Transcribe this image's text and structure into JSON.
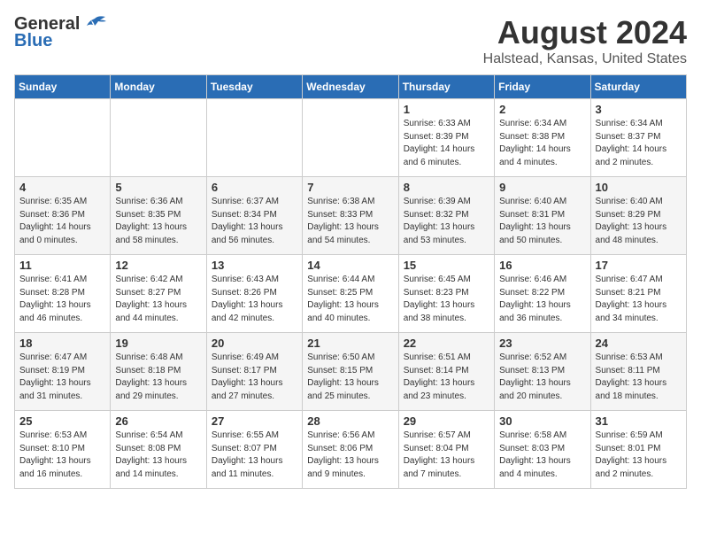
{
  "header": {
    "logo_general": "General",
    "logo_blue": "Blue",
    "month": "August 2024",
    "location": "Halstead, Kansas, United States"
  },
  "weekdays": [
    "Sunday",
    "Monday",
    "Tuesday",
    "Wednesday",
    "Thursday",
    "Friday",
    "Saturday"
  ],
  "weeks": [
    [
      {
        "day": "",
        "info": ""
      },
      {
        "day": "",
        "info": ""
      },
      {
        "day": "",
        "info": ""
      },
      {
        "day": "",
        "info": ""
      },
      {
        "day": "1",
        "info": "Sunrise: 6:33 AM\nSunset: 8:39 PM\nDaylight: 14 hours\nand 6 minutes."
      },
      {
        "day": "2",
        "info": "Sunrise: 6:34 AM\nSunset: 8:38 PM\nDaylight: 14 hours\nand 4 minutes."
      },
      {
        "day": "3",
        "info": "Sunrise: 6:34 AM\nSunset: 8:37 PM\nDaylight: 14 hours\nand 2 minutes."
      }
    ],
    [
      {
        "day": "4",
        "info": "Sunrise: 6:35 AM\nSunset: 8:36 PM\nDaylight: 14 hours\nand 0 minutes."
      },
      {
        "day": "5",
        "info": "Sunrise: 6:36 AM\nSunset: 8:35 PM\nDaylight: 13 hours\nand 58 minutes."
      },
      {
        "day": "6",
        "info": "Sunrise: 6:37 AM\nSunset: 8:34 PM\nDaylight: 13 hours\nand 56 minutes."
      },
      {
        "day": "7",
        "info": "Sunrise: 6:38 AM\nSunset: 8:33 PM\nDaylight: 13 hours\nand 54 minutes."
      },
      {
        "day": "8",
        "info": "Sunrise: 6:39 AM\nSunset: 8:32 PM\nDaylight: 13 hours\nand 53 minutes."
      },
      {
        "day": "9",
        "info": "Sunrise: 6:40 AM\nSunset: 8:31 PM\nDaylight: 13 hours\nand 50 minutes."
      },
      {
        "day": "10",
        "info": "Sunrise: 6:40 AM\nSunset: 8:29 PM\nDaylight: 13 hours\nand 48 minutes."
      }
    ],
    [
      {
        "day": "11",
        "info": "Sunrise: 6:41 AM\nSunset: 8:28 PM\nDaylight: 13 hours\nand 46 minutes."
      },
      {
        "day": "12",
        "info": "Sunrise: 6:42 AM\nSunset: 8:27 PM\nDaylight: 13 hours\nand 44 minutes."
      },
      {
        "day": "13",
        "info": "Sunrise: 6:43 AM\nSunset: 8:26 PM\nDaylight: 13 hours\nand 42 minutes."
      },
      {
        "day": "14",
        "info": "Sunrise: 6:44 AM\nSunset: 8:25 PM\nDaylight: 13 hours\nand 40 minutes."
      },
      {
        "day": "15",
        "info": "Sunrise: 6:45 AM\nSunset: 8:23 PM\nDaylight: 13 hours\nand 38 minutes."
      },
      {
        "day": "16",
        "info": "Sunrise: 6:46 AM\nSunset: 8:22 PM\nDaylight: 13 hours\nand 36 minutes."
      },
      {
        "day": "17",
        "info": "Sunrise: 6:47 AM\nSunset: 8:21 PM\nDaylight: 13 hours\nand 34 minutes."
      }
    ],
    [
      {
        "day": "18",
        "info": "Sunrise: 6:47 AM\nSunset: 8:19 PM\nDaylight: 13 hours\nand 31 minutes."
      },
      {
        "day": "19",
        "info": "Sunrise: 6:48 AM\nSunset: 8:18 PM\nDaylight: 13 hours\nand 29 minutes."
      },
      {
        "day": "20",
        "info": "Sunrise: 6:49 AM\nSunset: 8:17 PM\nDaylight: 13 hours\nand 27 minutes."
      },
      {
        "day": "21",
        "info": "Sunrise: 6:50 AM\nSunset: 8:15 PM\nDaylight: 13 hours\nand 25 minutes."
      },
      {
        "day": "22",
        "info": "Sunrise: 6:51 AM\nSunset: 8:14 PM\nDaylight: 13 hours\nand 23 minutes."
      },
      {
        "day": "23",
        "info": "Sunrise: 6:52 AM\nSunset: 8:13 PM\nDaylight: 13 hours\nand 20 minutes."
      },
      {
        "day": "24",
        "info": "Sunrise: 6:53 AM\nSunset: 8:11 PM\nDaylight: 13 hours\nand 18 minutes."
      }
    ],
    [
      {
        "day": "25",
        "info": "Sunrise: 6:53 AM\nSunset: 8:10 PM\nDaylight: 13 hours\nand 16 minutes."
      },
      {
        "day": "26",
        "info": "Sunrise: 6:54 AM\nSunset: 8:08 PM\nDaylight: 13 hours\nand 14 minutes."
      },
      {
        "day": "27",
        "info": "Sunrise: 6:55 AM\nSunset: 8:07 PM\nDaylight: 13 hours\nand 11 minutes."
      },
      {
        "day": "28",
        "info": "Sunrise: 6:56 AM\nSunset: 8:06 PM\nDaylight: 13 hours\nand 9 minutes."
      },
      {
        "day": "29",
        "info": "Sunrise: 6:57 AM\nSunset: 8:04 PM\nDaylight: 13 hours\nand 7 minutes."
      },
      {
        "day": "30",
        "info": "Sunrise: 6:58 AM\nSunset: 8:03 PM\nDaylight: 13 hours\nand 4 minutes."
      },
      {
        "day": "31",
        "info": "Sunrise: 6:59 AM\nSunset: 8:01 PM\nDaylight: 13 hours\nand 2 minutes."
      }
    ]
  ]
}
